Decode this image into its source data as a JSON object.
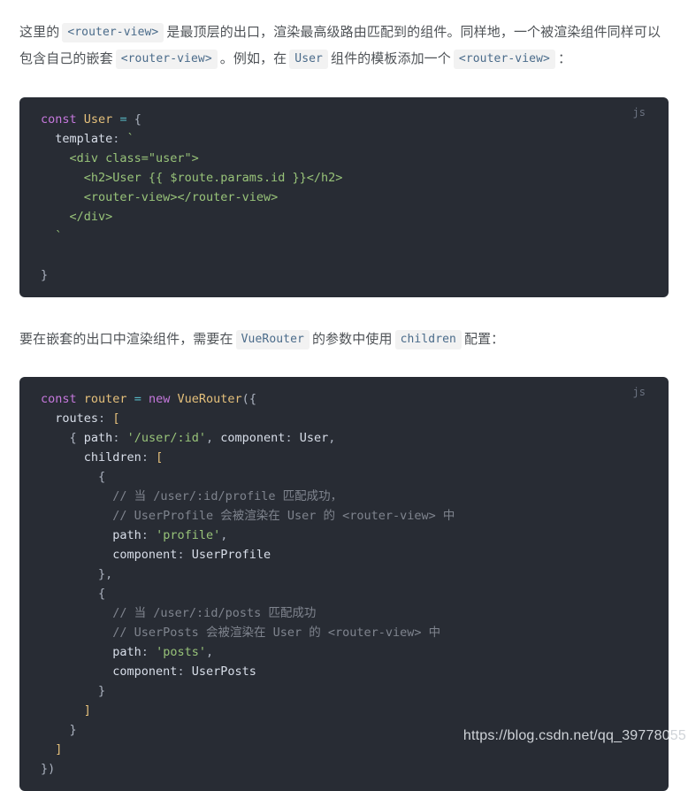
{
  "page": {
    "background": "#ffffff",
    "text_color": "#4f5357",
    "code_bg": "#282c34",
    "chip_bg": "#f2f2f2",
    "chip_text": "#4a6b8a"
  },
  "paragraphs": {
    "first": {
      "s1": "这里的",
      "chip1": "<router-view>",
      "s2": "是最顶层的出口，渲染最高级路由匹配到的组件。同样地，一个被渲染组件同样可以包含自己的嵌套",
      "chip2": "<router-view>",
      "s3": "。例如，在",
      "chip3": "User",
      "s4": "组件的模板添加一个",
      "chip4": "<router-view>",
      "s5": "："
    },
    "second": {
      "s1": "要在嵌套的出口中渲染组件，需要在",
      "chip1": "VueRouter",
      "s2": "的参数中使用",
      "chip2": "children",
      "s3": "配置："
    }
  },
  "code_block_1": {
    "lang_label": "js",
    "lines": [
      "const User = {",
      "  template: `",
      "    <div class=\"user\">",
      "      <h2>User {{ $route.params.id }}</h2>",
      "      <router-view></router-view>",
      "    </div>",
      "  `",
      "",
      "}"
    ]
  },
  "code_block_2": {
    "lang_label": "js",
    "lines": [
      "const router = new VueRouter({",
      "  routes: [",
      "    { path: '/user/:id', component: User,",
      "      children: [",
      "        {",
      "          // 当 /user/:id/profile 匹配成功，",
      "          // UserProfile 会被渲染在 User 的 <router-view> 中",
      "          path: 'profile',",
      "          component: UserProfile",
      "        },",
      "        {",
      "          // 当 /user/:id/posts 匹配成功",
      "          // UserPosts 会被渲染在 User 的 <router-view> 中",
      "          path: 'posts',",
      "          component: UserPosts",
      "        }",
      "      ]",
      "    }",
      "  ]",
      "})"
    ]
  },
  "watermark": {
    "text": "https://blog.csdn.net/qq_39778055"
  }
}
